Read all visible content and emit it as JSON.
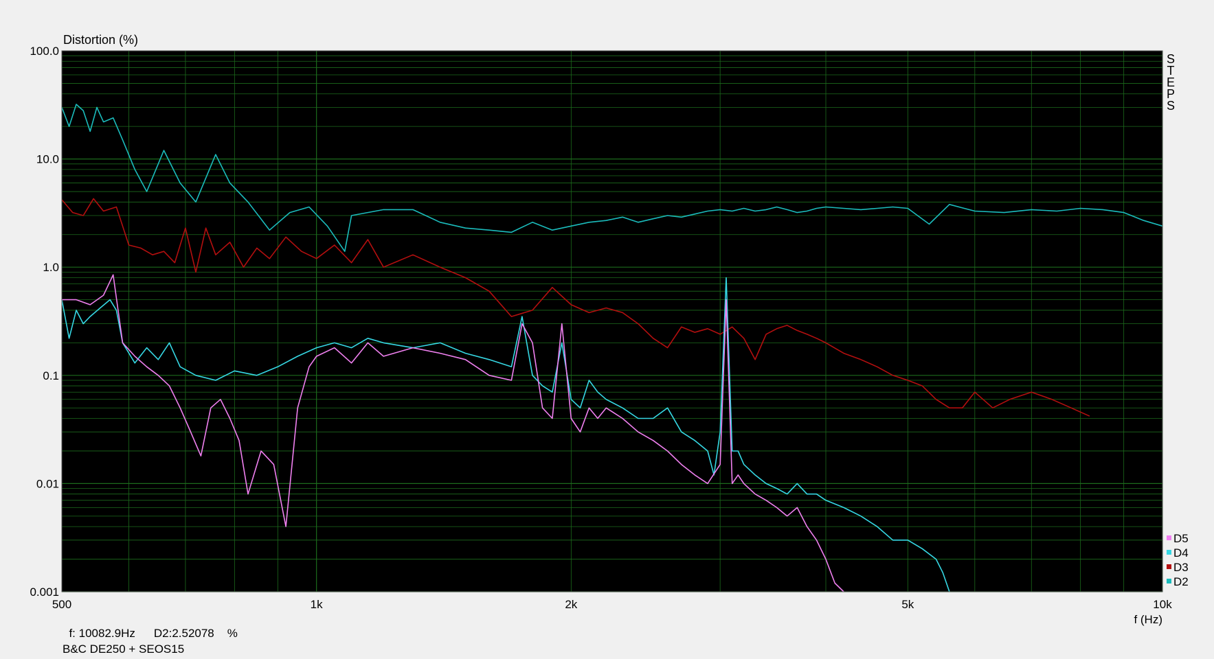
{
  "chart_data": {
    "type": "line",
    "ylabel": "Distortion (%)",
    "xlabel": "f (Hz)",
    "y_scale": "log",
    "x_scale": "log",
    "xlim": [
      500,
      10000
    ],
    "ylim": [
      0.001,
      100
    ],
    "y_ticks": [
      {
        "v": 100,
        "label": "100.0"
      },
      {
        "v": 10,
        "label": "10.0"
      },
      {
        "v": 1,
        "label": "1.0"
      },
      {
        "v": 0.1,
        "label": "0.1"
      },
      {
        "v": 0.01,
        "label": "0.01"
      },
      {
        "v": 0.001,
        "label": "0.001"
      }
    ],
    "x_ticks": [
      {
        "v": 500,
        "label": "500"
      },
      {
        "v": 1000,
        "label": "1k"
      },
      {
        "v": 2000,
        "label": "2k"
      },
      {
        "v": 5000,
        "label": "5k"
      },
      {
        "v": 10000,
        "label": "10k"
      }
    ],
    "side_label": "STEPS",
    "legend_position": "bottom-right",
    "background": "#000000",
    "grid_color": "#1c6b1c",
    "series": [
      {
        "name": "D2",
        "color": "#1bbcbc",
        "points": [
          [
            500,
            30
          ],
          [
            510,
            20
          ],
          [
            520,
            32
          ],
          [
            530,
            28
          ],
          [
            540,
            18
          ],
          [
            550,
            30
          ],
          [
            560,
            22
          ],
          [
            575,
            24
          ],
          [
            590,
            15
          ],
          [
            610,
            8
          ],
          [
            630,
            5
          ],
          [
            660,
            12
          ],
          [
            690,
            6
          ],
          [
            720,
            4
          ],
          [
            760,
            11
          ],
          [
            790,
            6
          ],
          [
            830,
            4
          ],
          [
            880,
            2.2
          ],
          [
            930,
            3.2
          ],
          [
            980,
            3.6
          ],
          [
            1030,
            2.4
          ],
          [
            1080,
            1.4
          ],
          [
            1100,
            3.0
          ],
          [
            1200,
            3.4
          ],
          [
            1300,
            3.4
          ],
          [
            1400,
            2.6
          ],
          [
            1500,
            2.3
          ],
          [
            1600,
            2.2
          ],
          [
            1700,
            2.1
          ],
          [
            1800,
            2.6
          ],
          [
            1900,
            2.2
          ],
          [
            2000,
            2.4
          ],
          [
            2100,
            2.6
          ],
          [
            2200,
            2.7
          ],
          [
            2300,
            2.9
          ],
          [
            2400,
            2.6
          ],
          [
            2500,
            2.8
          ],
          [
            2600,
            3.0
          ],
          [
            2700,
            2.9
          ],
          [
            2800,
            3.1
          ],
          [
            2900,
            3.3
          ],
          [
            3000,
            3.4
          ],
          [
            3100,
            3.3
          ],
          [
            3200,
            3.5
          ],
          [
            3300,
            3.3
          ],
          [
            3400,
            3.4
          ],
          [
            3500,
            3.6
          ],
          [
            3600,
            3.4
          ],
          [
            3700,
            3.2
          ],
          [
            3800,
            3.3
          ],
          [
            3900,
            3.5
          ],
          [
            4000,
            3.6
          ],
          [
            4200,
            3.5
          ],
          [
            4400,
            3.4
          ],
          [
            4600,
            3.5
          ],
          [
            4800,
            3.6
          ],
          [
            5000,
            3.5
          ],
          [
            5300,
            2.5
          ],
          [
            5600,
            3.8
          ],
          [
            6000,
            3.3
          ],
          [
            6500,
            3.2
          ],
          [
            7000,
            3.4
          ],
          [
            7500,
            3.3
          ],
          [
            8000,
            3.5
          ],
          [
            8500,
            3.4
          ],
          [
            9000,
            3.2
          ],
          [
            9500,
            2.7
          ],
          [
            10000,
            2.4
          ]
        ]
      },
      {
        "name": "D3",
        "color": "#b40f0f",
        "points": [
          [
            500,
            4.2
          ],
          [
            515,
            3.2
          ],
          [
            530,
            3.0
          ],
          [
            545,
            4.3
          ],
          [
            560,
            3.3
          ],
          [
            580,
            3.6
          ],
          [
            600,
            1.6
          ],
          [
            620,
            1.5
          ],
          [
            640,
            1.3
          ],
          [
            660,
            1.4
          ],
          [
            680,
            1.1
          ],
          [
            700,
            2.3
          ],
          [
            720,
            0.9
          ],
          [
            740,
            2.3
          ],
          [
            760,
            1.3
          ],
          [
            790,
            1.7
          ],
          [
            820,
            1.0
          ],
          [
            850,
            1.5
          ],
          [
            880,
            1.2
          ],
          [
            920,
            1.9
          ],
          [
            960,
            1.4
          ],
          [
            1000,
            1.2
          ],
          [
            1050,
            1.6
          ],
          [
            1100,
            1.1
          ],
          [
            1150,
            1.8
          ],
          [
            1200,
            1.0
          ],
          [
            1300,
            1.3
          ],
          [
            1400,
            1.0
          ],
          [
            1500,
            0.8
          ],
          [
            1600,
            0.6
          ],
          [
            1700,
            0.35
          ],
          [
            1800,
            0.4
          ],
          [
            1900,
            0.65
          ],
          [
            2000,
            0.45
          ],
          [
            2100,
            0.38
          ],
          [
            2200,
            0.42
          ],
          [
            2300,
            0.38
          ],
          [
            2400,
            0.3
          ],
          [
            2500,
            0.22
          ],
          [
            2600,
            0.18
          ],
          [
            2700,
            0.28
          ],
          [
            2800,
            0.25
          ],
          [
            2900,
            0.27
          ],
          [
            3000,
            0.24
          ],
          [
            3100,
            0.28
          ],
          [
            3200,
            0.22
          ],
          [
            3300,
            0.14
          ],
          [
            3400,
            0.24
          ],
          [
            3500,
            0.27
          ],
          [
            3600,
            0.29
          ],
          [
            3700,
            0.26
          ],
          [
            3800,
            0.24
          ],
          [
            3900,
            0.22
          ],
          [
            4000,
            0.2
          ],
          [
            4200,
            0.16
          ],
          [
            4400,
            0.14
          ],
          [
            4600,
            0.12
          ],
          [
            4800,
            0.1
          ],
          [
            5000,
            0.09
          ],
          [
            5200,
            0.08
          ],
          [
            5400,
            0.06
          ],
          [
            5600,
            0.05
          ],
          [
            5800,
            0.05
          ],
          [
            6000,
            0.07
          ],
          [
            6300,
            0.05
          ],
          [
            6600,
            0.06
          ],
          [
            7000,
            0.07
          ],
          [
            7400,
            0.06
          ],
          [
            7800,
            0.05
          ],
          [
            8200,
            0.042
          ]
        ]
      },
      {
        "name": "D4",
        "color": "#36d8e4",
        "points": [
          [
            500,
            0.5
          ],
          [
            510,
            0.22
          ],
          [
            520,
            0.4
          ],
          [
            530,
            0.3
          ],
          [
            540,
            0.35
          ],
          [
            555,
            0.42
          ],
          [
            570,
            0.5
          ],
          [
            580,
            0.4
          ],
          [
            590,
            0.2
          ],
          [
            610,
            0.13
          ],
          [
            630,
            0.18
          ],
          [
            650,
            0.14
          ],
          [
            670,
            0.2
          ],
          [
            690,
            0.12
          ],
          [
            720,
            0.1
          ],
          [
            760,
            0.09
          ],
          [
            800,
            0.11
          ],
          [
            850,
            0.1
          ],
          [
            900,
            0.12
          ],
          [
            950,
            0.15
          ],
          [
            1000,
            0.18
          ],
          [
            1050,
            0.2
          ],
          [
            1100,
            0.18
          ],
          [
            1150,
            0.22
          ],
          [
            1200,
            0.2
          ],
          [
            1300,
            0.18
          ],
          [
            1400,
            0.2
          ],
          [
            1500,
            0.16
          ],
          [
            1600,
            0.14
          ],
          [
            1700,
            0.12
          ],
          [
            1750,
            0.35
          ],
          [
            1800,
            0.1
          ],
          [
            1850,
            0.08
          ],
          [
            1900,
            0.07
          ],
          [
            1950,
            0.2
          ],
          [
            2000,
            0.06
          ],
          [
            2050,
            0.05
          ],
          [
            2100,
            0.09
          ],
          [
            2150,
            0.07
          ],
          [
            2200,
            0.06
          ],
          [
            2300,
            0.05
          ],
          [
            2400,
            0.04
          ],
          [
            2500,
            0.04
          ],
          [
            2600,
            0.05
          ],
          [
            2700,
            0.03
          ],
          [
            2800,
            0.025
          ],
          [
            2900,
            0.02
          ],
          [
            2950,
            0.012
          ],
          [
            3000,
            0.03
          ],
          [
            3050,
            0.8
          ],
          [
            3100,
            0.02
          ],
          [
            3150,
            0.02
          ],
          [
            3200,
            0.015
          ],
          [
            3300,
            0.012
          ],
          [
            3400,
            0.01
          ],
          [
            3500,
            0.009
          ],
          [
            3600,
            0.008
          ],
          [
            3700,
            0.01
          ],
          [
            3800,
            0.008
          ],
          [
            3900,
            0.008
          ],
          [
            4000,
            0.007
          ],
          [
            4200,
            0.006
          ],
          [
            4400,
            0.005
          ],
          [
            4600,
            0.004
          ],
          [
            4800,
            0.003
          ],
          [
            5000,
            0.003
          ],
          [
            5200,
            0.0025
          ],
          [
            5400,
            0.002
          ],
          [
            5500,
            0.0015
          ],
          [
            5600,
            0.001
          ]
        ]
      },
      {
        "name": "D5",
        "color": "#f080f0",
        "points": [
          [
            500,
            0.5
          ],
          [
            520,
            0.5
          ],
          [
            540,
            0.45
          ],
          [
            560,
            0.55
          ],
          [
            575,
            0.85
          ],
          [
            590,
            0.2
          ],
          [
            610,
            0.15
          ],
          [
            630,
            0.12
          ],
          [
            650,
            0.1
          ],
          [
            670,
            0.08
          ],
          [
            690,
            0.05
          ],
          [
            710,
            0.03
          ],
          [
            730,
            0.018
          ],
          [
            750,
            0.05
          ],
          [
            770,
            0.06
          ],
          [
            790,
            0.04
          ],
          [
            810,
            0.025
          ],
          [
            830,
            0.008
          ],
          [
            860,
            0.02
          ],
          [
            890,
            0.015
          ],
          [
            920,
            0.004
          ],
          [
            950,
            0.05
          ],
          [
            980,
            0.12
          ],
          [
            1000,
            0.15
          ],
          [
            1050,
            0.18
          ],
          [
            1100,
            0.13
          ],
          [
            1150,
            0.2
          ],
          [
            1200,
            0.15
          ],
          [
            1300,
            0.18
          ],
          [
            1400,
            0.16
          ],
          [
            1500,
            0.14
          ],
          [
            1600,
            0.1
          ],
          [
            1700,
            0.09
          ],
          [
            1750,
            0.3
          ],
          [
            1800,
            0.2
          ],
          [
            1850,
            0.05
          ],
          [
            1900,
            0.04
          ],
          [
            1950,
            0.3
          ],
          [
            2000,
            0.04
          ],
          [
            2050,
            0.03
          ],
          [
            2100,
            0.05
          ],
          [
            2150,
            0.04
          ],
          [
            2200,
            0.05
          ],
          [
            2300,
            0.04
          ],
          [
            2400,
            0.03
          ],
          [
            2500,
            0.025
          ],
          [
            2600,
            0.02
          ],
          [
            2700,
            0.015
          ],
          [
            2800,
            0.012
          ],
          [
            2900,
            0.01
          ],
          [
            3000,
            0.015
          ],
          [
            3050,
            0.5
          ],
          [
            3100,
            0.01
          ],
          [
            3150,
            0.012
          ],
          [
            3200,
            0.01
          ],
          [
            3300,
            0.008
          ],
          [
            3400,
            0.007
          ],
          [
            3500,
            0.006
          ],
          [
            3600,
            0.005
          ],
          [
            3700,
            0.006
          ],
          [
            3800,
            0.004
          ],
          [
            3900,
            0.003
          ],
          [
            4000,
            0.002
          ],
          [
            4100,
            0.0012
          ],
          [
            4200,
            0.001
          ]
        ]
      }
    ]
  },
  "readout": {
    "freq": "f: 10082.9Hz",
    "value": "D2:2.52078",
    "unit": "%"
  },
  "subtitle": "B&C DE250 + SEOS15"
}
